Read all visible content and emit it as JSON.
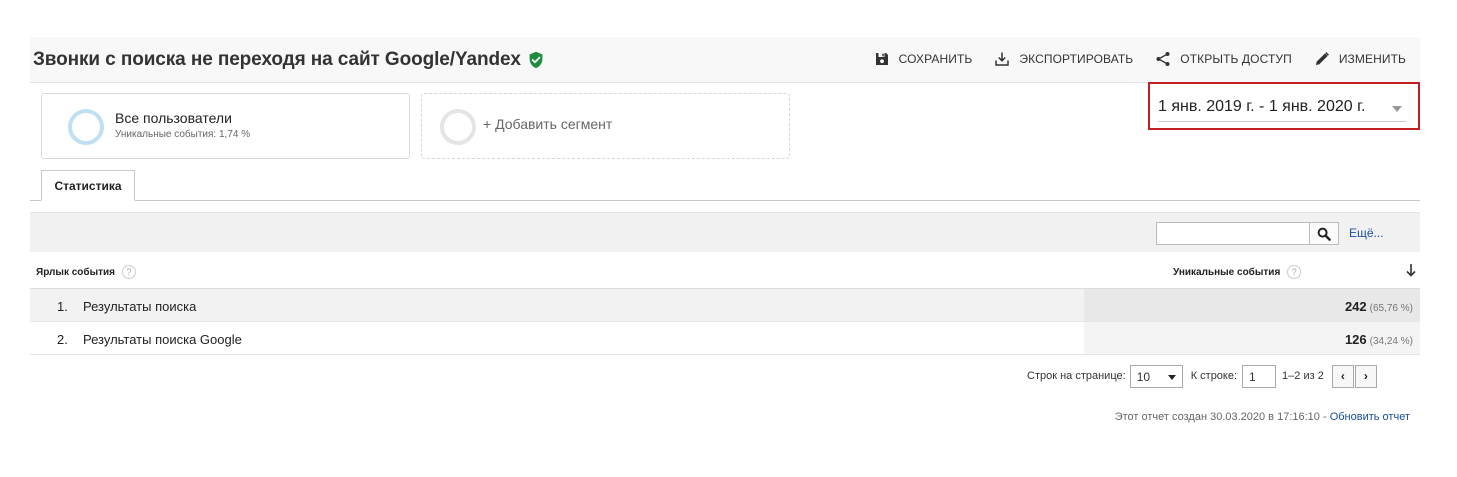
{
  "header": {
    "title": "Звонки с поиска не переходя на сайт Google/Yandex",
    "actions": {
      "save": "СОХРАНИТЬ",
      "export": "ЭКСПОРТИРОВАТЬ",
      "share": "ОТКРЫТЬ ДОСТУП",
      "edit": "ИЗМЕНИТЬ"
    }
  },
  "segments": {
    "active": {
      "name": "Все пользователи",
      "sub": "Уникальные события: 1,74 %"
    },
    "add_label": "+ Добавить сегмент"
  },
  "date_range": "1 янв. 2019 г. - 1 янв. 2020 г.",
  "tabs": [
    {
      "label": "Статистика"
    }
  ],
  "search": {
    "value": "",
    "more_label": "Ещё..."
  },
  "table": {
    "columns": {
      "label": "Ярлык события",
      "metric": "Уникальные события",
      "help": "?"
    },
    "rows": [
      {
        "num": "1.",
        "label": "Результаты поиска",
        "value": "242",
        "pct": "(65,76 %)"
      },
      {
        "num": "2.",
        "label": "Результаты поиска Google",
        "value": "126",
        "pct": "(34,24 %)"
      }
    ]
  },
  "pagination": {
    "rows_per_page_label": "Строк на странице:",
    "rows_per_page": "10",
    "goto_label": "К строке:",
    "goto_value": "1",
    "range": "1–2 из 2",
    "prev": "‹",
    "next": "›"
  },
  "footer": {
    "created": "Этот отчет создан 30.03.2020 в 17:16:10 - ",
    "refresh": "Обновить отчет"
  },
  "colors": {
    "verified": "#1e8e3e",
    "date_highlight": "#c0201f",
    "link": "#1a4ea3"
  }
}
